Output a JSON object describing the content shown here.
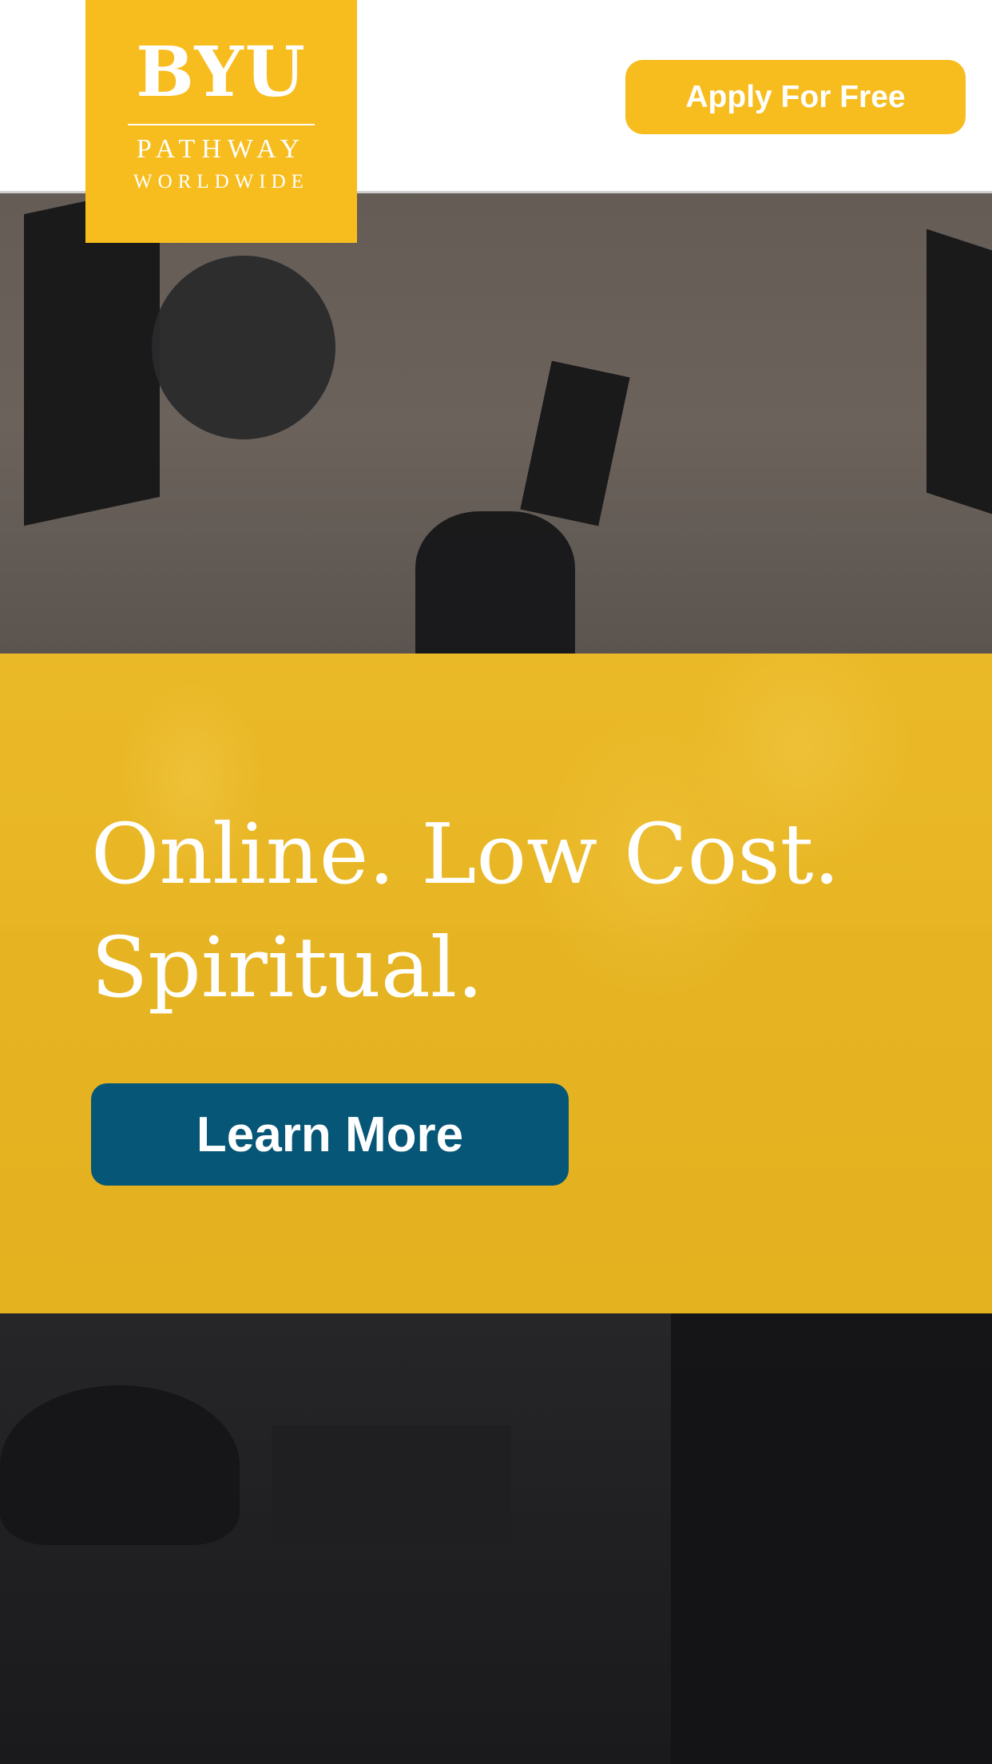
{
  "header": {
    "logo": {
      "main": "BYU",
      "line1": "PATHWAY",
      "line2": "WORLDWIDE"
    },
    "apply_button_label": "Apply For Free"
  },
  "hero": {
    "headline_line1": "Online. Low Cost.",
    "headline_line2": "Spiritual.",
    "learn_more_label": "Learn More"
  },
  "colors": {
    "brand_yellow": "#f7bd1f",
    "button_blue": "#065677",
    "header_bg": "#ffffff"
  }
}
